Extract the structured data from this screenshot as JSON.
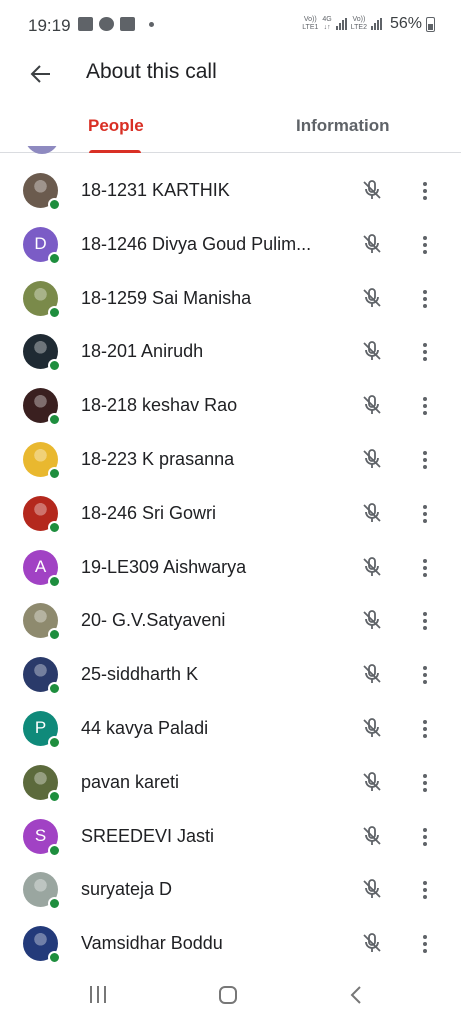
{
  "status_bar": {
    "time": "19:19",
    "net1_top": "Vo))",
    "net1_bottom": "LTE1",
    "net2_top": "4G",
    "net3_top": "Vo))",
    "net3_bottom": "LTE2",
    "battery": "56%"
  },
  "header": {
    "title": "About this call"
  },
  "tabs": {
    "people": "People",
    "information": "Information"
  },
  "colors": {
    "accent": "#d93025",
    "presence": "#1e8e3e",
    "icon_gray": "#5f6368"
  },
  "participants": [
    {
      "name": "18-1231 KARTHIK",
      "avatar_type": "photo",
      "avatar_color": "#6b5b4e"
    },
    {
      "name": "18-1246 Divya Goud Pulim...",
      "avatar_type": "letter",
      "letter": "D",
      "avatar_color": "#7b5cc6"
    },
    {
      "name": "18-1259 Sai Manisha",
      "avatar_type": "photo",
      "avatar_color": "#7a8a4a"
    },
    {
      "name": "18-201 Anirudh",
      "avatar_type": "photo",
      "avatar_color": "#1f2a33"
    },
    {
      "name": "18-218 keshav Rao",
      "avatar_type": "photo",
      "avatar_color": "#3a2020"
    },
    {
      "name": "18-223 K prasanna",
      "avatar_type": "photo",
      "avatar_color": "#e9b82f"
    },
    {
      "name": "18-246 Sri Gowri",
      "avatar_type": "photo",
      "avatar_color": "#b4281d"
    },
    {
      "name": "19-LE309 Aishwarya",
      "avatar_type": "letter",
      "letter": "A",
      "avatar_color": "#a142c4"
    },
    {
      "name": "20- G.V.Satyaveni",
      "avatar_type": "photo",
      "avatar_color": "#8e8a6e"
    },
    {
      "name": "25-siddharth K",
      "avatar_type": "photo",
      "avatar_color": "#2a3a6a"
    },
    {
      "name": "44 kavya Paladi",
      "avatar_type": "letter",
      "letter": "P",
      "avatar_color": "#0f8a7a"
    },
    {
      "name": "pavan kareti",
      "avatar_type": "photo",
      "avatar_color": "#5c6a3c"
    },
    {
      "name": "SREEDEVI Jasti",
      "avatar_type": "letter",
      "letter": "S",
      "avatar_color": "#a142c4"
    },
    {
      "name": "suryateja D",
      "avatar_type": "photo",
      "avatar_color": "#9aa6a0"
    },
    {
      "name": "Vamsidhar Boddu",
      "avatar_type": "photo",
      "avatar_color": "#233a7a"
    }
  ],
  "icons": {
    "mute": "mic-off-icon",
    "more": "more-vert-icon",
    "back": "arrow-back-icon"
  }
}
